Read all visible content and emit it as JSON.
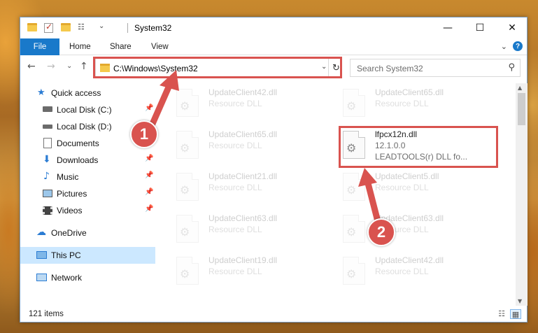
{
  "window": {
    "title": "System32",
    "controls": {
      "minimize": "—",
      "maximize": "☐",
      "close": "✕"
    }
  },
  "ribbon": {
    "tabs": [
      "File",
      "Home",
      "Share",
      "View"
    ],
    "expand": "⌄",
    "help": "?"
  },
  "nav": {
    "back": "←",
    "forward": "→",
    "recent": "⌄",
    "up": "↑",
    "address": "C:\\Windows\\System32",
    "address_dropdown": "⌄",
    "refresh": "↻",
    "search_placeholder": "Search System32",
    "search_icon": "⚲"
  },
  "sidebar": {
    "items": [
      {
        "label": "Quick access",
        "icon": "star-icon",
        "pinned": false
      },
      {
        "label": "Local Disk (C:)",
        "icon": "drive-icon",
        "pinned": true
      },
      {
        "label": "Local Disk (D:)",
        "icon": "drive-icon",
        "pinned": false
      },
      {
        "label": "Documents",
        "icon": "documents-icon",
        "pinned": true
      },
      {
        "label": "Downloads",
        "icon": "download-icon",
        "pinned": true
      },
      {
        "label": "Music",
        "icon": "music-icon",
        "pinned": true
      },
      {
        "label": "Pictures",
        "icon": "pictures-icon",
        "pinned": true
      },
      {
        "label": "Videos",
        "icon": "videos-icon",
        "pinned": true
      },
      {
        "label": "OneDrive",
        "icon": "cloud-icon",
        "pinned": false
      },
      {
        "label": "This PC",
        "icon": "computer-icon",
        "pinned": false,
        "selected": true
      },
      {
        "label": "Network",
        "icon": "network-icon",
        "pinned": false
      }
    ],
    "pin_glyph": "📌"
  },
  "files": [
    {
      "name": "UpdateClient42.dll",
      "desc": "Resource DLL",
      "faded": true
    },
    {
      "name": "UpdateClient65.dll",
      "desc": "Resource DLL",
      "faded": true
    },
    {
      "name": "UpdateClient65.dll",
      "desc": "Resource DLL",
      "faded": true
    },
    {
      "name": "lfpcx12n.dll",
      "desc": "12.1.0.0",
      "desc2": "LEADTOOLS(r) DLL fo...",
      "faded": false
    },
    {
      "name": "UpdateClient21.dll",
      "desc": "Resource DLL",
      "faded": true
    },
    {
      "name": "UpdateClient5.dll",
      "desc": "Resource DLL",
      "faded": true
    },
    {
      "name": "UpdateClient63.dll",
      "desc": "Resource DLL",
      "faded": true
    },
    {
      "name": "UpdateClient63.dll",
      "desc": "Resource DLL",
      "faded": true
    },
    {
      "name": "UpdateClient19.dll",
      "desc": "Resource DLL",
      "faded": true
    },
    {
      "name": "UpdateClient42.dll",
      "desc": "Resource DLL",
      "faded": true
    }
  ],
  "file_icon_glyph": "⚙",
  "status": {
    "items": "121 items"
  },
  "view_buttons": {
    "details": "☷",
    "large": "▦"
  },
  "callouts": [
    "1",
    "2"
  ],
  "colors": {
    "accent": "#1979ca",
    "highlight": "#d9534f",
    "selected": "#cce8ff"
  }
}
